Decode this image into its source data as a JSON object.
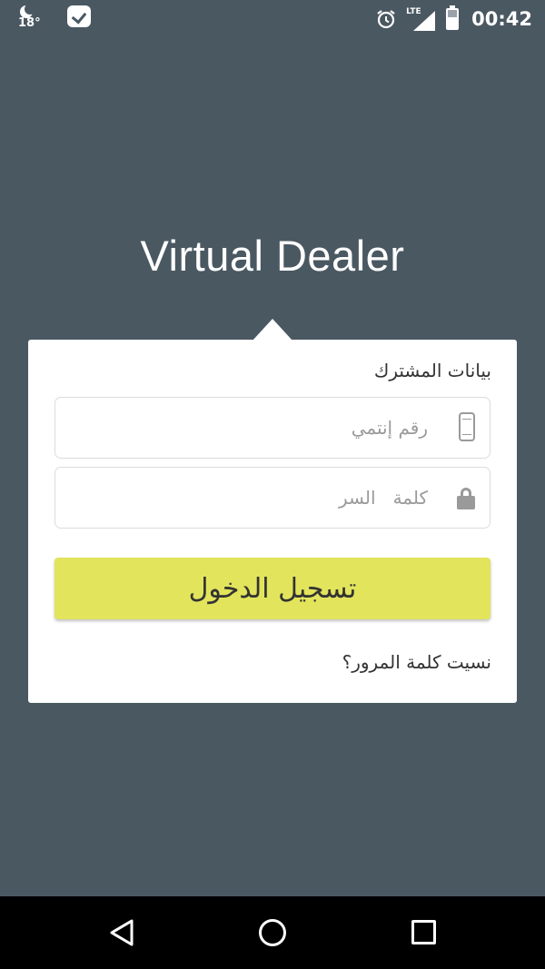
{
  "status_bar": {
    "temperature": "18°",
    "time": "00:42",
    "network": "LTE",
    "icons": [
      "weather-night-icon",
      "check-badge-icon",
      "alarm-clock-icon",
      "signal-icon",
      "battery-icon"
    ]
  },
  "app": {
    "title": "Virtual Dealer"
  },
  "login_form": {
    "section_label": "بيانات المشترك",
    "phone_placeholder": "رقم إنتمي",
    "password_placeholder": "كلمة   السر",
    "submit_label": "تسجيل الدخول",
    "forgot_link": "نسيت كلمة المرور؟",
    "button_color": "#e2e45c"
  },
  "nav_bar": {
    "icons": [
      "back-icon",
      "home-icon",
      "recents-icon"
    ]
  },
  "colors": {
    "background": "#4a5862",
    "card": "#ffffff",
    "accent": "#e2e45c"
  }
}
